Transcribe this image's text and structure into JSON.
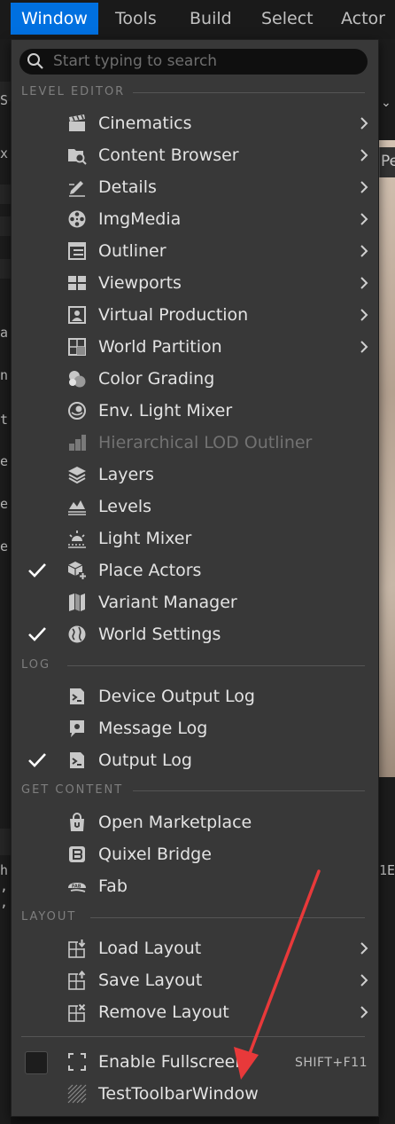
{
  "menubar": {
    "items": [
      {
        "label": "Window",
        "active": true
      },
      {
        "label": "Tools"
      },
      {
        "label": "Build"
      },
      {
        "label": "Select"
      },
      {
        "label": "Actor"
      }
    ]
  },
  "background": {
    "left_snippets": [
      "S",
      "x",
      "a",
      "n",
      "t",
      "e",
      "e",
      "e",
      "h",
      ",",
      ","
    ],
    "right_tab": "Pe",
    "right_code": "1E"
  },
  "search": {
    "placeholder": "Start typing to search",
    "value": ""
  },
  "sections": {
    "level_editor": "LEVEL EDITOR",
    "log": "LOG",
    "get_content": "GET CONTENT",
    "layout": "LAYOUT"
  },
  "level_editor_items": [
    {
      "label": "Cinematics",
      "icon": "clapperboard-icon",
      "submenu": true
    },
    {
      "label": "Content Browser",
      "icon": "folder-search-icon",
      "submenu": true
    },
    {
      "label": "Details",
      "icon": "pencil-icon",
      "submenu": true
    },
    {
      "label": "ImgMedia",
      "icon": "film-reel-icon",
      "submenu": true
    },
    {
      "label": "Outliner",
      "icon": "list-icon",
      "submenu": true
    },
    {
      "label": "Viewports",
      "icon": "viewports-icon",
      "submenu": true
    },
    {
      "label": "Virtual Production",
      "icon": "person-frame-icon",
      "submenu": true
    },
    {
      "label": "World Partition",
      "icon": "grid-icon",
      "submenu": true
    },
    {
      "label": "Color Grading",
      "icon": "color-wheel-icon"
    },
    {
      "label": "Env. Light Mixer",
      "icon": "sky-sphere-icon"
    },
    {
      "label": "Hierarchical LOD Outliner",
      "icon": "lod-icon",
      "disabled": true
    },
    {
      "label": "Layers",
      "icon": "layers-icon"
    },
    {
      "label": "Levels",
      "icon": "levels-icon"
    },
    {
      "label": "Light Mixer",
      "icon": "light-icon"
    },
    {
      "label": "Place Actors",
      "icon": "cube-plus-icon",
      "checked": true
    },
    {
      "label": "Variant Manager",
      "icon": "variant-icon"
    },
    {
      "label": "World Settings",
      "icon": "globe-icon",
      "checked": true
    }
  ],
  "log_items": [
    {
      "label": "Device Output Log",
      "icon": "terminal-icon"
    },
    {
      "label": "Message Log",
      "icon": "message-icon"
    },
    {
      "label": "Output Log",
      "icon": "terminal-icon",
      "checked": true
    }
  ],
  "content_items": [
    {
      "label": "Open Marketplace",
      "icon": "marketplace-bag-icon"
    },
    {
      "label": "Quixel Bridge",
      "icon": "bridge-icon"
    },
    {
      "label": "Fab",
      "icon": "fab-icon"
    }
  ],
  "layout_items": [
    {
      "label": "Load Layout",
      "icon": "load-layout-icon",
      "submenu": true
    },
    {
      "label": "Save Layout",
      "icon": "save-layout-icon",
      "submenu": true
    },
    {
      "label": "Remove Layout",
      "icon": "remove-layout-icon",
      "submenu": true
    }
  ],
  "misc_items": [
    {
      "label": "Enable Fullscreen",
      "icon": "fullscreen-icon",
      "shortcut": "SHIFT+F11"
    },
    {
      "label": "TestToolbarWindow",
      "icon": "hatched-icon"
    }
  ],
  "annotation": {
    "arrow_color": "#e8393a"
  },
  "colors": {
    "menu_bg": "#383838",
    "accent": "#0070e0"
  }
}
